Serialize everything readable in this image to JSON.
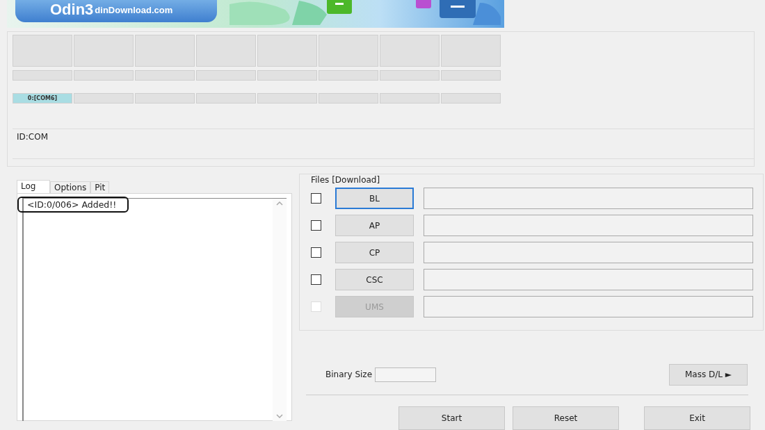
{
  "banner": {
    "title": "Odin3",
    "site": "dinDownload.com"
  },
  "ports": [
    {
      "label": "0:[COM6]",
      "connected": true
    },
    {
      "connected": false
    },
    {
      "connected": false
    },
    {
      "connected": false
    },
    {
      "connected": false
    },
    {
      "connected": false
    },
    {
      "connected": false
    },
    {
      "connected": false
    }
  ],
  "id_com": {
    "label": "ID:COM"
  },
  "log_tabs": [
    {
      "label": "Log",
      "selected": true
    },
    {
      "label": "Options",
      "selected": false
    },
    {
      "label": "Pit",
      "selected": false
    }
  ],
  "log": {
    "lines": [
      {
        "text": "<ID:0/006> Added!!",
        "circled": true
      }
    ]
  },
  "files": {
    "title": "Files [Download]",
    "rows": [
      {
        "label": "BL",
        "checked": false,
        "disabled": false,
        "focused": true
      },
      {
        "label": "AP",
        "checked": false,
        "disabled": false,
        "focused": false
      },
      {
        "label": "CP",
        "checked": false,
        "disabled": false,
        "focused": false
      },
      {
        "label": "CSC",
        "checked": false,
        "disabled": false,
        "focused": false
      },
      {
        "label": "UMS",
        "checked": false,
        "disabled": true,
        "focused": false
      }
    ]
  },
  "binary_size": {
    "label": "Binary Size"
  },
  "mass_dl": {
    "label": "Mass D/L ►"
  },
  "buttons": [
    {
      "label": "Start"
    },
    {
      "label": "Reset"
    },
    {
      "label": "Exit"
    }
  ]
}
